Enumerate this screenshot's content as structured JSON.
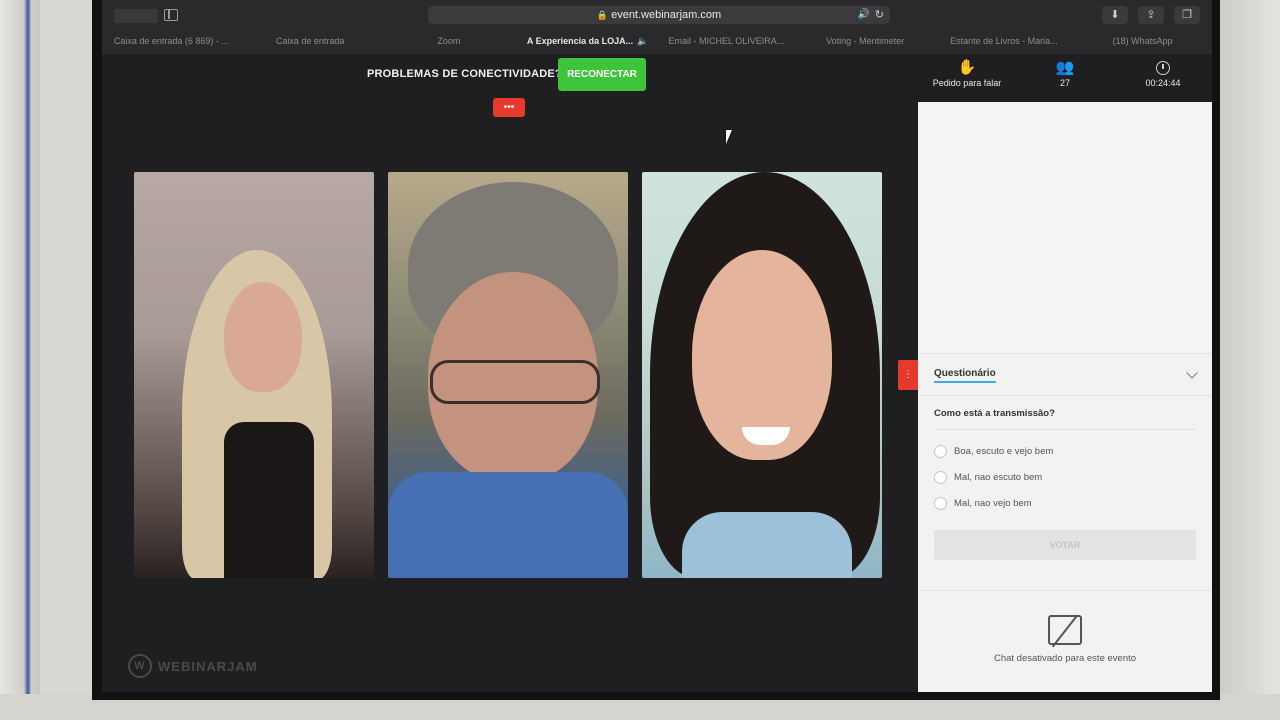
{
  "browser": {
    "url": "event.webinarjam.com",
    "tabs": [
      {
        "label": "Caixa de entrada (6 869) - ...",
        "active": false
      },
      {
        "label": "Caixa de entrada",
        "active": false
      },
      {
        "label": "Zoom",
        "active": false
      },
      {
        "label": "A Experiencia da LOJA...",
        "active": true
      },
      {
        "label": "Email - MICHEL OLIVEIRA...",
        "active": false
      },
      {
        "label": "Voting - Mentimeter",
        "active": false
      },
      {
        "label": "Estante de Livros - Maria...",
        "active": false
      },
      {
        "label": "(18) WhatsApp",
        "active": false
      }
    ]
  },
  "stage": {
    "connection_text": "PROBLEMAS DE CONECTIVIDADE?",
    "reconnect_label": "RECONECTAR",
    "dots_label": "•••",
    "brand": "WEBINARJAM"
  },
  "toolbar": {
    "raise_hand_label": "Pedido para falar",
    "attendees_count": "27",
    "timer": "00:24:44"
  },
  "quiz": {
    "title": "Questionário",
    "question": "Como está a transmissão?",
    "options": [
      "Boa, escuto e vejo bem",
      "Mal, nao escuto bem",
      "Mal, nao vejo bem"
    ],
    "vote_label": "VOTAR"
  },
  "chat": {
    "disabled_text": "Chat desativado para este evento"
  }
}
